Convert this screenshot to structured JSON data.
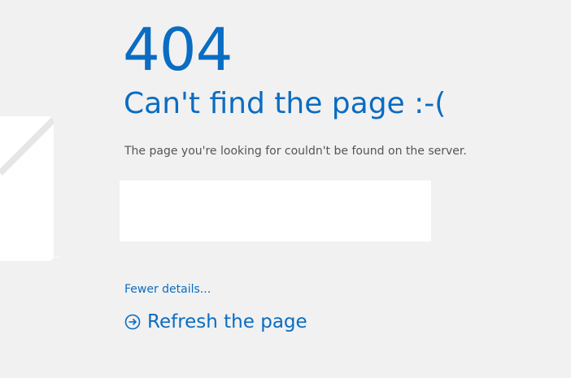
{
  "error": {
    "code": "404",
    "headline": "Can't find the page :-(",
    "message": "The page you're looking for couldn't be found on the server."
  },
  "logo": {
    "trademark": "™"
  },
  "actions": {
    "fewer_details_label": "Fewer details...",
    "refresh_label": "Refresh the page"
  },
  "colors": {
    "accent": "#0a6cc2",
    "background": "#f1f1f1",
    "body_text": "#555555"
  },
  "icons": {
    "refresh": "circle-arrow-right-icon"
  }
}
